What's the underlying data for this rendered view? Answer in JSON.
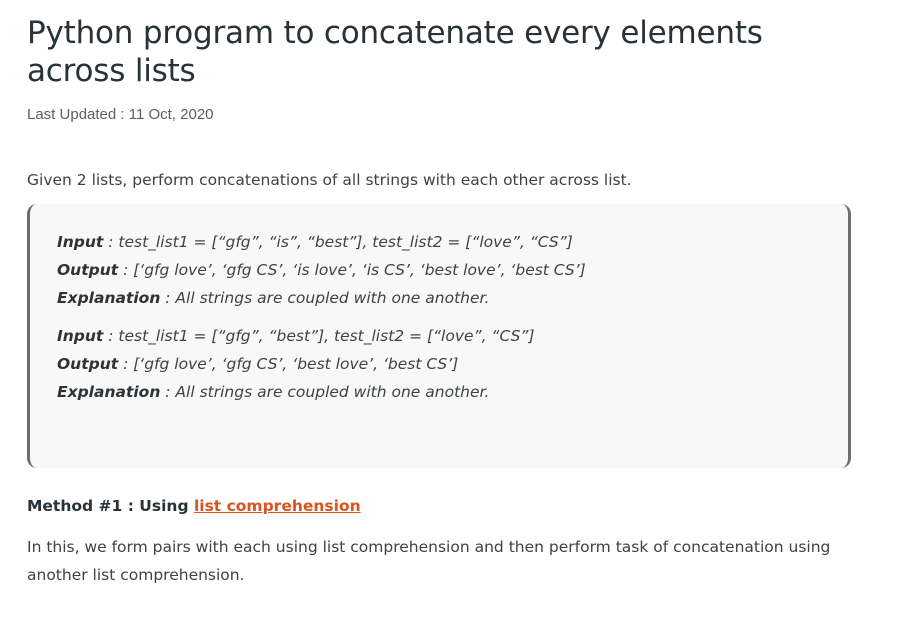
{
  "article": {
    "title": "Python program to concatenate every elements across lists",
    "last_updated": "Last Updated : 11 Oct, 2020",
    "intro": "Given 2 lists, perform concatenations of all strings with each other across list."
  },
  "examples": [
    {
      "input_label": "Input",
      "input_value": " : test_list1 = [“gfg”, “is”, “best”], test_list2 = [“love”, “CS”]",
      "output_label": "Output",
      "output_value": " : [‘gfg love’, ‘gfg CS’, ‘is love’, ‘is CS’, ‘best love’, ‘best CS’]",
      "explanation_label": "Explanation",
      "explanation_value": " : All strings are coupled with one another."
    },
    {
      "input_label": "Input",
      "input_value": " : test_list1 = [“gfg”, “best”], test_list2 = [“love”, “CS”]",
      "output_label": "Output",
      "output_value": " : [‘gfg love’, ‘gfg CS’, ‘best love’, ‘best CS’]",
      "explanation_label": "Explanation",
      "explanation_value": " : All strings are coupled with one another."
    }
  ],
  "method": {
    "prefix": "Method #1 : Using ",
    "link_text": "list comprehension",
    "link_color": "#d9541e",
    "description": "In this, we form pairs with each using list comprehension and then perform task of concatenation using another list comprehension."
  }
}
